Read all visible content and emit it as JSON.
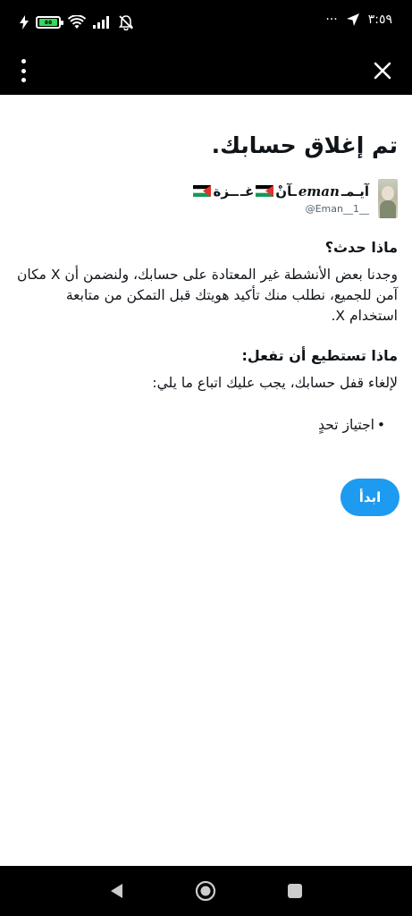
{
  "status_bar": {
    "time": "٣:٥٩",
    "battery_level": "٥٥",
    "more": "···"
  },
  "top_bar": {
    "close_label": "X"
  },
  "page": {
    "title": "تم إغلاق حسابك.",
    "user": {
      "display_name_part1": "آيـمـ",
      "display_name_latin": "eman",
      "display_name_part2": "ـآنْ",
      "display_name_part3": "غـ",
      "display_name_part4": "ــزة",
      "handle": "@Eman__1__"
    },
    "what_happened": {
      "heading": "ماذا حدث؟",
      "text": "وجدنا بعض الأنشطة غير المعتادة على حسابك، ولنضمن أن X مكان آمن للجميع، نطلب منك تأكيد هويتك قبل التمكن من متابعة استخدام X."
    },
    "what_you_can_do": {
      "heading": "ماذا تستطيع أن تفعل:",
      "text": "لإلغاء قفل حسابك، يجب عليك اتباع ما يلي:",
      "items": [
        "اجتياز تحدٍ"
      ]
    },
    "start_button": "ابدأ"
  },
  "colors": {
    "accent": "#1d9bf0",
    "bar_bg": "#000000"
  }
}
